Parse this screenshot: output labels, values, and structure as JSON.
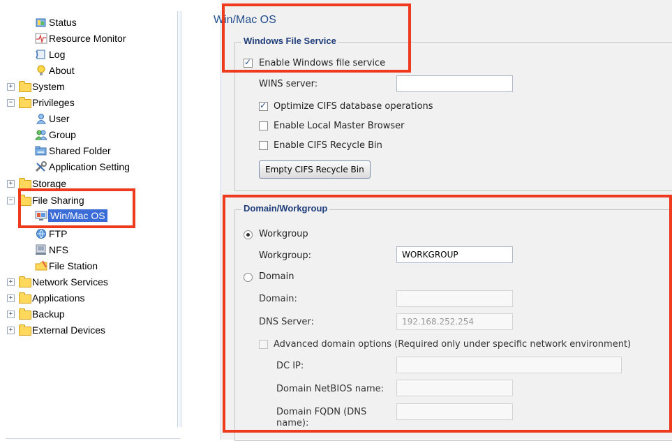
{
  "sidebar": {
    "items": [
      {
        "label": "Status",
        "icon": "status-icon"
      },
      {
        "label": "Resource Monitor",
        "icon": "resource-monitor-icon"
      },
      {
        "label": "Log",
        "icon": "log-icon"
      },
      {
        "label": "About",
        "icon": "lightbulb-icon"
      },
      {
        "label": "System",
        "icon": "folder-icon"
      },
      {
        "label": "Privileges",
        "icon": "folder-open-icon"
      },
      {
        "label": "User",
        "icon": "user-icon"
      },
      {
        "label": "Group",
        "icon": "group-icon"
      },
      {
        "label": "Shared Folder",
        "icon": "shared-folder-icon"
      },
      {
        "label": "Application Setting",
        "icon": "application-setting-icon"
      },
      {
        "label": "Storage",
        "icon": "folder-icon"
      },
      {
        "label": "File Sharing",
        "icon": "folder-open-icon"
      },
      {
        "label": "Win/Mac OS",
        "icon": "win-mac-os-icon"
      },
      {
        "label": "FTP",
        "icon": "ftp-icon"
      },
      {
        "label": "NFS",
        "icon": "nfs-icon"
      },
      {
        "label": "File Station",
        "icon": "file-station-icon"
      },
      {
        "label": "Network Services",
        "icon": "folder-icon"
      },
      {
        "label": "Applications",
        "icon": "folder-icon"
      },
      {
        "label": "Backup",
        "icon": "folder-icon"
      },
      {
        "label": "External Devices",
        "icon": "folder-icon"
      }
    ],
    "expand_glyph": "+",
    "collapse_glyph": "−",
    "selected": "Win/Mac OS"
  },
  "main": {
    "title": "Win/Mac OS",
    "windows_file_service": {
      "legend": "Windows File Service",
      "enable_label": "Enable Windows file service",
      "enable_checked": true,
      "wins_label": "WINS server:",
      "wins_value": "",
      "optimize_label": "Optimize CIFS database operations",
      "optimize_checked": true,
      "local_master_label": "Enable Local Master Browser",
      "local_master_checked": false,
      "recycle_label": "Enable CIFS Recycle Bin",
      "recycle_checked": false,
      "empty_recycle_button": "Empty CIFS Recycle Bin"
    },
    "domain_workgroup": {
      "legend": "Domain/Workgroup",
      "workgroup_radio": "Workgroup",
      "workgroup_selected": true,
      "workgroup_label": "Workgroup:",
      "workgroup_value": "WORKGROUP",
      "domain_radio": "Domain",
      "domain_label": "Domain:",
      "domain_value": "",
      "dns_label": "DNS Server:",
      "dns_value": "192.168.252.254",
      "advanced_label": "Advanced domain options (Required only under specific network environment)",
      "dc_ip_label": "DC IP:",
      "dc_ip_value": "",
      "netbios_label": "Domain NetBIOS name:",
      "netbios_value": "",
      "fqdn_label_line1": "Domain FQDN (DNS",
      "fqdn_label_line2": "name):",
      "fqdn_value": ""
    }
  },
  "colors": {
    "highlight": "#ee3b1e",
    "selection": "#3a6bd6",
    "title": "#224c8c",
    "legend": "#1f3d7a"
  }
}
